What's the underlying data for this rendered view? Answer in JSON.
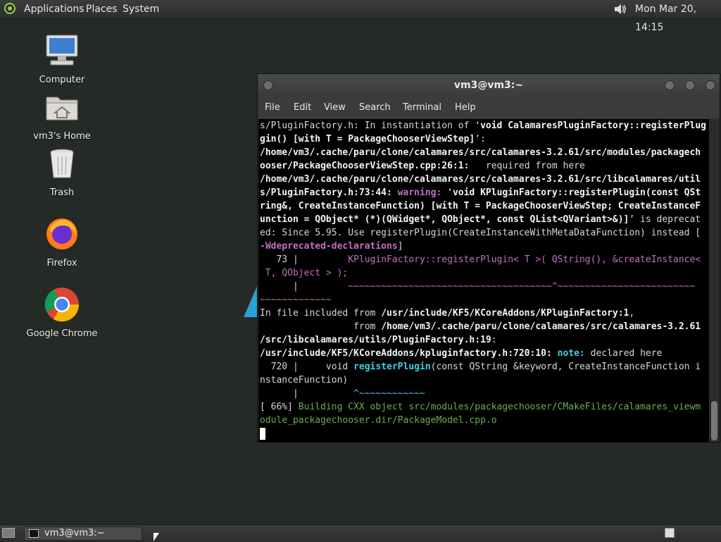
{
  "top_panel": {
    "menus": [
      "Applications",
      "Places",
      "System"
    ],
    "clock": "Mon Mar 20, 14:15"
  },
  "desktop_icons": [
    {
      "label": "Computer",
      "icon": "computer-icon"
    },
    {
      "label": "vm3's Home",
      "icon": "home-folder-icon"
    },
    {
      "label": "Trash",
      "icon": "trash-icon"
    },
    {
      "label": "Firefox",
      "icon": "firefox-icon"
    },
    {
      "label": "Google Chrome",
      "icon": "chrome-icon"
    }
  ],
  "terminal": {
    "title": "vm3@vm3:~",
    "menu": [
      "File",
      "Edit",
      "View",
      "Search",
      "Terminal",
      "Help"
    ],
    "lines": [
      [
        {
          "t": "s/PluginFactory.h: In instantiation of ‘"
        },
        {
          "t": "void CalamaresPluginFactory::registerPlug",
          "c": "b"
        }
      ],
      [
        {
          "t": "gin() [with T = PackageChooserViewStep]",
          "c": "b"
        },
        {
          "t": "’:"
        }
      ],
      [
        {
          "t": "/home/vm3/.cache/paru/clone/calamares/src/calamares-3.2.61/src/modules/packagech",
          "c": "b"
        }
      ],
      [
        {
          "t": "ooser/PackageChooserViewStep.cpp:26:1:",
          "c": "b"
        },
        {
          "t": "   required from here"
        }
      ],
      [
        {
          "t": "/home/vm3/.cache/paru/clone/calamares/src/calamares-3.2.61/src/libcalamares/util",
          "c": "b"
        }
      ],
      [
        {
          "t": "s/PluginFactory.h:73:44:",
          "c": "b"
        },
        {
          "t": " "
        },
        {
          "t": "warning: ",
          "c": "warn"
        },
        {
          "t": "‘"
        },
        {
          "t": "void KPluginFactory::registerPlugin(const QSt",
          "c": "b"
        }
      ],
      [
        {
          "t": "ring&, CreateInstanceFunction) [with T = PackageChooserViewStep; CreateInstanceF",
          "c": "b"
        }
      ],
      [
        {
          "t": "unction = QObject* (*)(QWidget*, QObject*, const QList<QVariant>&)]",
          "c": "b"
        },
        {
          "t": "’ is deprecat"
        }
      ],
      [
        {
          "t": "ed: Since 5.95. Use registerPlugin(CreateInstanceWithMetaDataFunction) instead ["
        }
      ],
      [
        {
          "t": "-Wdeprecated-declarations",
          "c": "warn"
        },
        {
          "t": "]"
        }
      ],
      [
        {
          "t": "   73 |         "
        },
        {
          "t": "KPluginFactory::registerPlugin< T >( QString(), &createInstance<",
          "c": "mag"
        }
      ],
      [
        {
          "t": " T, QObject > );",
          "c": "mag"
        }
      ],
      [
        {
          "t": "      |         "
        },
        {
          "t": "~~~~~~~~~~~~~~~~~~~~~~~~~~~~~~~~~~~~~^~~~~~~~~~~~~~~~~~~~~~~~~~",
          "c": "warnc"
        }
      ],
      [
        {
          "t": "~~~~~~~~~~~~~",
          "c": "warnc"
        }
      ],
      [
        {
          "t": "In file included from "
        },
        {
          "t": "/usr/include/KF5/KCoreAddons/KPluginFactory:1",
          "c": "b"
        },
        {
          "t": ","
        }
      ],
      [
        {
          "t": "                 from "
        },
        {
          "t": "/home/vm3/.cache/paru/clone/calamares/src/calamares-3.2.61",
          "c": "b"
        }
      ],
      [
        {
          "t": "/src/libcalamares/utils/PluginFactory.h:19",
          "c": "b"
        },
        {
          "t": ":"
        }
      ],
      [
        {
          "t": "/usr/include/KF5/KCoreAddons/kpluginfactory.h:720:10:",
          "c": "b"
        },
        {
          "t": " "
        },
        {
          "t": "note: ",
          "c": "note"
        },
        {
          "t": "declared here"
        }
      ],
      [
        {
          "t": "  720 |     void "
        },
        {
          "t": "registerPlugin",
          "c": "cyanf"
        },
        {
          "t": "(const QString &keyword, CreateInstanceFunction i"
        }
      ],
      [
        {
          "t": "nstanceFunction)"
        }
      ],
      [
        {
          "t": "      |          "
        },
        {
          "t": "^~~~~~~~~~~~~",
          "c": "caret"
        }
      ],
      [
        {
          "t": "[ 66%] "
        },
        {
          "t": "Building CXX object src/modules/packagechooser/CMakeFiles/calamares_viewm",
          "c": "green"
        }
      ],
      [
        {
          "t": "odule_packagechooser.dir/PackageModel.cpp.o",
          "c": "green"
        }
      ]
    ]
  },
  "taskbar": {
    "task_label": "vm3@vm3:~"
  }
}
